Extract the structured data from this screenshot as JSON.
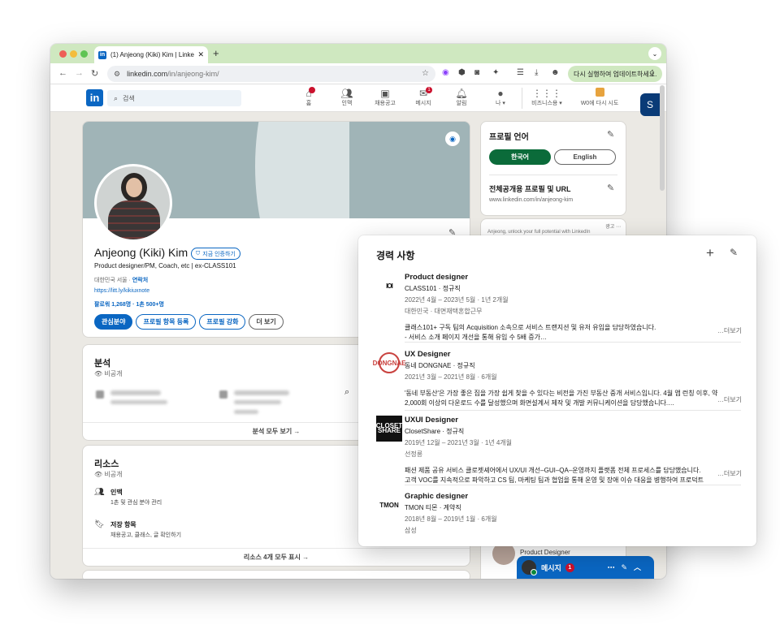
{
  "browser": {
    "tab_title": "(1) Anjeong (Kiki) Kim | Linke...",
    "tab_favicon": "in",
    "new_tab": "+",
    "url_host": "linkedin.com",
    "url_path": "/in/anjeong-kim/",
    "update_label": "다시 실행하여 업데이트하세요.",
    "accent": "#cfe8c0"
  },
  "nav": {
    "logo": "in",
    "search_placeholder": "검색",
    "items": [
      {
        "label": "홈",
        "icon": "home-icon",
        "badge": ""
      },
      {
        "label": "인맥",
        "icon": "people-icon",
        "badge": ""
      },
      {
        "label": "채용공고",
        "icon": "briefcase-icon",
        "badge": ""
      },
      {
        "label": "메시지",
        "icon": "message-icon",
        "badge": "1"
      },
      {
        "label": "알림",
        "icon": "bell-icon",
        "badge": ""
      },
      {
        "label": "나 ▾",
        "icon": "me-avatar",
        "badge": ""
      },
      {
        "label": "비즈니스용 ▾",
        "icon": "grid-icon",
        "badge": ""
      },
      {
        "label": "W0에 다시 시도",
        "icon": "premium-icon",
        "badge": ""
      }
    ],
    "brand_color": "#0a66c2"
  },
  "profile": {
    "name": "Anjeong (Kiki) Kim",
    "verify_label": "지금 인증하기",
    "headline": "Product designer/PM, Coach, etc | ex-CLASS101",
    "location": "대한민국 서울 · ",
    "contact_label": "연락처",
    "link": "https://litt.ly/kikiuxnote",
    "stats": "팔로워 1,268명 · 1촌 500+명",
    "buttons": {
      "interests": "관심분야",
      "add_section": "프로필 항목 등록",
      "enhance": "프로필 강화",
      "more": "더 보기"
    }
  },
  "analytics": {
    "title": "분석",
    "visibility": "비공개",
    "footer": "분석 모두 보기 →"
  },
  "resources": {
    "title": "리소스",
    "visibility": "비공개",
    "items": [
      {
        "title": "인맥",
        "subtitle": "1촌 및 관심 분야 관리"
      },
      {
        "title": "저장 항목",
        "subtitle": "채용공고, 클래스, 글 확인하기"
      }
    ],
    "footer": "리소스 4개 모두 표시 →"
  },
  "right": {
    "lang_title": "프로필 언어",
    "lang_primary": "한국어",
    "lang_secondary": "English",
    "public_title": "전체공개용 프로필 및 URL",
    "public_url": "www.linkedin.com/in/anjeong-kim",
    "ad_label": "광고",
    "ad_text": "Anjeong, unlock your full potential with LinkedIn",
    "bottom_role": "Product Designer"
  },
  "messaging": {
    "label": "메시지",
    "badge": "1"
  },
  "experience": {
    "title": "경력 사항",
    "more_label": "…더보기",
    "jobs": [
      {
        "role": "Product designer",
        "company": "CLASS101 · 정규직",
        "dates": "2022년 4월 – 2023년 5월 · 1년 2개월",
        "location": "대한민국 · 대면재택혼합근무",
        "desc1": "클래스101+ 구독 팀의 Acquisition 소속으로 서비스 트랜지션 및 유저 유입을 담당하였습니다.",
        "desc2": "- 서비스 소개 페이지 개선을 통해 유입 수 5배 증가…",
        "logo": "IOI"
      },
      {
        "role": "UX Designer",
        "company": "동네 DONGNAE · 정규직",
        "dates": "2021년 3월 – 2021년 8월 · 6개월",
        "location": "",
        "desc1": "'동네 부동산'은 가장 좋은 집을 가장 쉽게 찾을 수 있다는 비전을 가진 부동산 중개 서비스입니다. 4월 앱 런칭 이후, 약",
        "desc2": "2,000회 이상의 다운로드 수를 달성했으며 화면설계서 제작 및 개발 커뮤니케이션을 담당했습니다.…",
        "logo": "DONGNAE"
      },
      {
        "role": "UXUI Designer",
        "company": "ClosetShare · 정규직",
        "dates": "2019년 12월 – 2021년 3월 · 1년 4개월",
        "location": "선정릉",
        "desc1": "패션 제품 공유 서비스 클로젯셰어에서 UX/UI 개선–GUI–QA–운영까지 플랫폼 전체 프로세스를 담당했습니다.",
        "desc2": "고객 VOC를 지속적으로 파악하고 CS 팀, 마케팅 팀과 협업을 통해 운영 및 장애 이슈 대응을 병행하여 프로덕트",
        "logo": "CLOSET SHARE"
      },
      {
        "role": "Graphic designer",
        "company": "TMON 티몬 · 계약직",
        "dates": "2018년 8월 – 2019년 1월 · 6개월",
        "location": "삼성",
        "desc1": "",
        "desc2": "",
        "logo": "TMON"
      }
    ]
  }
}
